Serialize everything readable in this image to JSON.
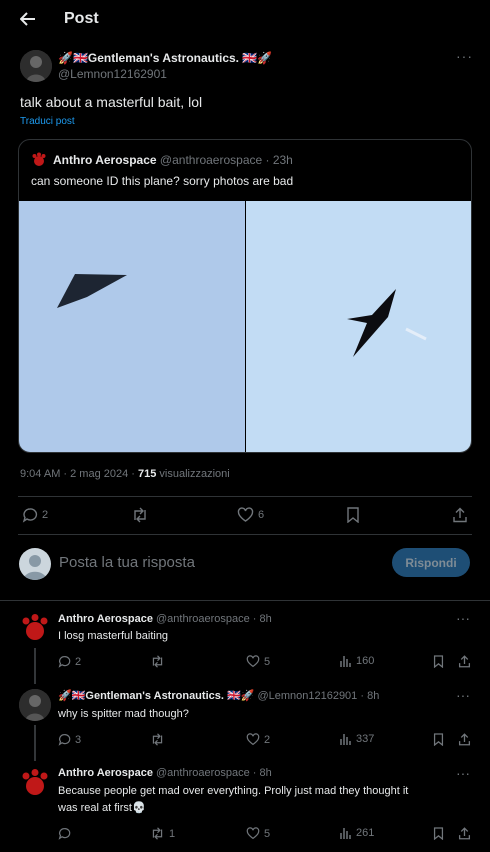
{
  "header": {
    "title": "Post"
  },
  "main_post": {
    "author_name": "🚀🇬🇧Gentleman's Astronautics. 🇬🇧🚀",
    "handle": "@Lemnon12162901",
    "text": "talk about a masterful bait, lol",
    "translate": "Traduci post",
    "quoted": {
      "author_name": "Anthro Aerospace",
      "handle_time": "@anthroaerospace · 23h",
      "text": "can someone ID this plane? sorry photos are bad"
    },
    "time": "9:04 AM · 2 mag 2024 · ",
    "views": "715",
    "views_label": " visualizzazioni",
    "replies": "2",
    "likes": "6"
  },
  "reply_box": {
    "placeholder": "Posta la tua risposta",
    "button": "Rispondi"
  },
  "replies": [
    {
      "author_name": "Anthro Aerospace",
      "handle_time": "@anthroaerospace · 8h",
      "text": "I losg masterful baiting",
      "replies": "2",
      "reposts": "",
      "likes": "5",
      "views": "160"
    },
    {
      "author_name": "🚀🇬🇧Gentleman's Astronautics. 🇬🇧🚀",
      "handle_time": "@Lemnon12162901 · 8h",
      "text": "why is spitter mad though?",
      "replies": "3",
      "reposts": "",
      "likes": "2",
      "views": "337"
    },
    {
      "author_name": "Anthro Aerospace",
      "handle_time": "@anthroaerospace · 8h",
      "text_line1": "Because people get mad over everything. Prolly just mad they thought it",
      "text_line2": "was real at first💀",
      "replies": "",
      "reposts": "1",
      "likes": "5",
      "views": "261"
    }
  ],
  "colors": {
    "accent": "#1d9bf0",
    "button_disabled": "#1e4e75",
    "sky": "#c2dcf4",
    "sky_left": "#afc9ea"
  }
}
